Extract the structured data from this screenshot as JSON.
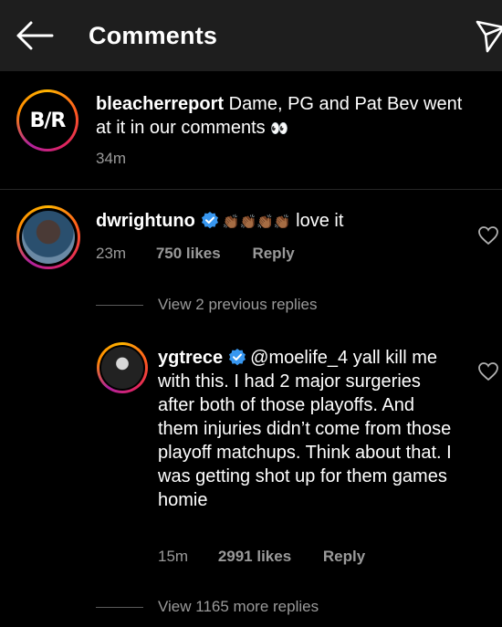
{
  "header": {
    "title": "Comments",
    "back_icon": "arrow-left-icon",
    "send_icon": "paper-plane-icon"
  },
  "caption": {
    "username": "bleacherreport",
    "text": " Dame, PG and Pat Bev went at it in our comments ",
    "eyes": "👀",
    "time": "34m",
    "avatar_logo": "B/R"
  },
  "comment1": {
    "username": "dwrightuno",
    "verified": true,
    "claps": "👏🏾👏🏾👏🏾👏🏾",
    "text": "love it",
    "time": "23m",
    "likes": "750 likes",
    "reply": "Reply"
  },
  "view_previous": "View 2 previous replies",
  "reply1": {
    "username": "ygtrece",
    "verified": true,
    "mention": "@moelife_4",
    "text": " yall kill me with this. I had 2 major surgeries after both of those playoffs. And them injuries didn’t come from those playoff matchups. Think about that. I was getting shot up for them games homie",
    "time": "15m",
    "likes": "2991 likes",
    "reply": "Reply"
  },
  "view_more": "View 1165 more replies",
  "colors": {
    "background": "#000000",
    "header": "#1e1e1e",
    "secondary_text": "#9a9a9a",
    "verified": "#3897f0"
  }
}
